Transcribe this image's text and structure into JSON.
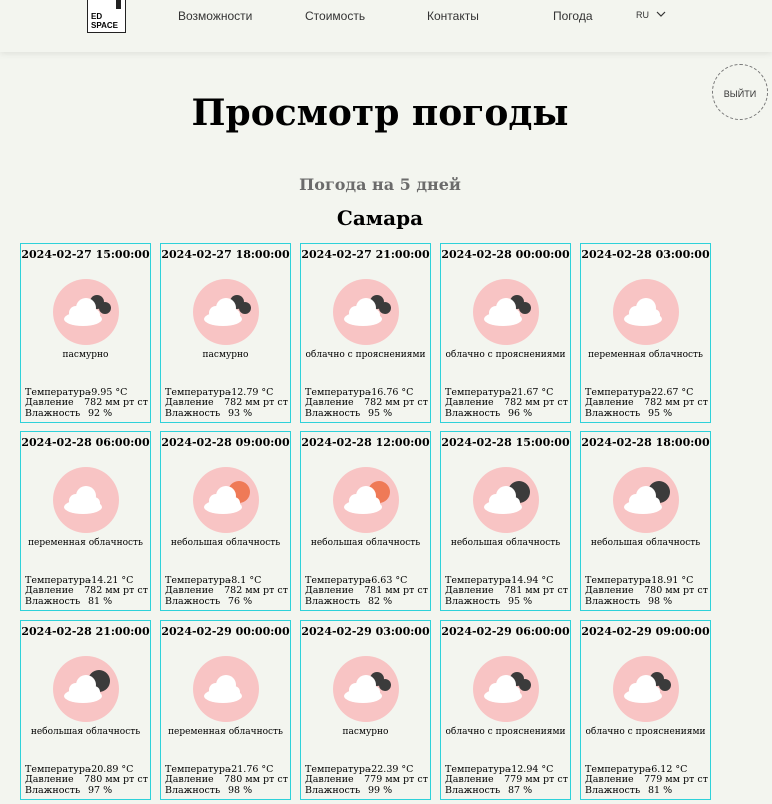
{
  "header": {
    "logo_line1": "ED",
    "logo_line2": "SPACE",
    "nav": [
      "Возможности",
      "Стоимость",
      "Контакты",
      "Погода"
    ],
    "lang": "RU",
    "logout": "ВЫЙТИ"
  },
  "page": {
    "title": "Просмотр погоды",
    "subtitle": "Погода на 5 дней",
    "city": "Самара"
  },
  "labels": {
    "temperature": "Температура",
    "pressure": "Давление",
    "humidity": "Влажность"
  },
  "forecast": [
    {
      "datetime": "2024-02-27 15:00:00",
      "icon": "cloud-dark",
      "desc": "пасмурно",
      "temp": "-9.95 °C",
      "pressure": "782 мм рт ст",
      "humidity": "92 %"
    },
    {
      "datetime": "2024-02-27 18:00:00",
      "icon": "cloud-dark",
      "desc": "пасмурно",
      "temp": "-12.79 °C",
      "pressure": "782 мм рт ст",
      "humidity": "93 %"
    },
    {
      "datetime": "2024-02-27 21:00:00",
      "icon": "cloud-dark",
      "desc": "облачно с прояснениями",
      "temp": "-16.76 °C",
      "pressure": "782 мм рт ст",
      "humidity": "95 %"
    },
    {
      "datetime": "2024-02-28 00:00:00",
      "icon": "cloud-dark",
      "desc": "облачно с прояснениями",
      "temp": "-21.67 °C",
      "pressure": "782 мм рт ст",
      "humidity": "96 %"
    },
    {
      "datetime": "2024-02-28 03:00:00",
      "icon": "cloud",
      "desc": "переменная облачность",
      "temp": "-22.67 °C",
      "pressure": "782 мм рт ст",
      "humidity": "95 %"
    },
    {
      "datetime": "2024-02-28 06:00:00",
      "icon": "cloud",
      "desc": "переменная облачность",
      "temp": "-14.21 °C",
      "pressure": "782 мм рт ст",
      "humidity": "81 %"
    },
    {
      "datetime": "2024-02-28 09:00:00",
      "icon": "cloud-sun",
      "desc": "небольшая облачность",
      "temp": "-8.1 °C",
      "pressure": "782 мм рт ст",
      "humidity": "76 %"
    },
    {
      "datetime": "2024-02-28 12:00:00",
      "icon": "cloud-sun",
      "desc": "небольшая облачность",
      "temp": "-6.63 °C",
      "pressure": "781 мм рт ст",
      "humidity": "82 %"
    },
    {
      "datetime": "2024-02-28 15:00:00",
      "icon": "cloud-moon",
      "desc": "небольшая облачность",
      "temp": "-14.94 °C",
      "pressure": "781 мм рт ст",
      "humidity": "95 %"
    },
    {
      "datetime": "2024-02-28 18:00:00",
      "icon": "cloud-moon",
      "desc": "небольшая облачность",
      "temp": "-18.91 °C",
      "pressure": "780 мм рт ст",
      "humidity": "98 %"
    },
    {
      "datetime": "2024-02-28 21:00:00",
      "icon": "cloud-moon",
      "desc": "небольшая облачность",
      "temp": "-20.89 °C",
      "pressure": "780 мм рт ст",
      "humidity": "97 %"
    },
    {
      "datetime": "2024-02-29 00:00:00",
      "icon": "cloud",
      "desc": "переменная облачность",
      "temp": "-21.76 °C",
      "pressure": "780 мм рт ст",
      "humidity": "98 %"
    },
    {
      "datetime": "2024-02-29 03:00:00",
      "icon": "cloud-dark",
      "desc": "пасмурно",
      "temp": "-22.39 °C",
      "pressure": "779 мм рт ст",
      "humidity": "99 %"
    },
    {
      "datetime": "2024-02-29 06:00:00",
      "icon": "cloud-dark",
      "desc": "облачно с прояснениями",
      "temp": "-12.94 °C",
      "pressure": "779 мм рт ст",
      "humidity": "87 %"
    },
    {
      "datetime": "2024-02-29 09:00:00",
      "icon": "cloud-dark",
      "desc": "облачно с прояснениями",
      "temp": "-6.12 °C",
      "pressure": "779 мм рт ст",
      "humidity": "81 %"
    }
  ],
  "colors": {
    "accent": "#2ed1d9",
    "icon_bg": "#f8c4c4",
    "sun": "#ef7a57",
    "moon": "#3b3b3b",
    "cloud": "#ffffff"
  }
}
